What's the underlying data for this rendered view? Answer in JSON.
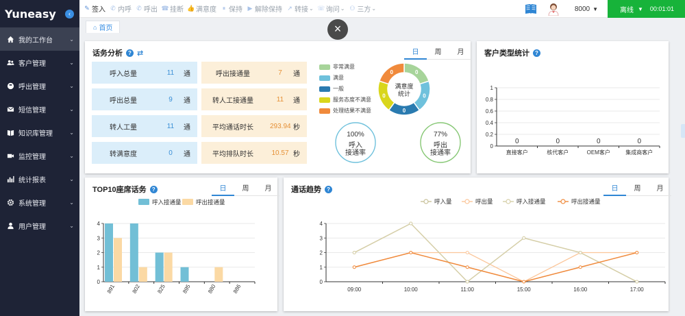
{
  "app": {
    "logo": "Yuneasy",
    "collapse_icon": "chevron-left-icon"
  },
  "sidebar": {
    "items": [
      {
        "label": "我的工作台",
        "icon": "home-icon",
        "active": true
      },
      {
        "label": "客户管理",
        "icon": "users-icon"
      },
      {
        "label": "呼出管理",
        "icon": "dial-icon"
      },
      {
        "label": "短信管理",
        "icon": "envelope-icon"
      },
      {
        "label": "知识库管理",
        "icon": "book-open-icon"
      },
      {
        "label": "监控管理",
        "icon": "video-icon"
      },
      {
        "label": "统计报表",
        "icon": "bar-chart-icon"
      },
      {
        "label": "系统管理",
        "icon": "gear-icon"
      },
      {
        "label": "用户管理",
        "icon": "user-icon"
      }
    ]
  },
  "toolbar": {
    "items": [
      {
        "label": "签入",
        "icon": "signin-icon",
        "enabled": true
      },
      {
        "label": "内呼",
        "icon": "phone-icon"
      },
      {
        "label": "呼出",
        "icon": "phone-out-icon"
      },
      {
        "label": "挂断",
        "icon": "hangup-icon"
      },
      {
        "label": "满意度",
        "icon": "thumb-icon"
      },
      {
        "label": "保持",
        "icon": "pause-icon"
      },
      {
        "label": "解除保持",
        "icon": "play-icon"
      },
      {
        "label": "转接",
        "icon": "transfer-icon",
        "caret": true
      },
      {
        "label": "询问",
        "icon": "ask-icon",
        "caret": true
      },
      {
        "label": "三方",
        "icon": "conference-icon",
        "caret": true
      }
    ],
    "extension": "8000",
    "status": "离线",
    "timer": "00:01:01"
  },
  "tabs": {
    "home": "首页"
  },
  "traffic": {
    "title": "话务分析",
    "periods": [
      "日",
      "周",
      "月"
    ],
    "stats": [
      {
        "label": "呼入总量",
        "value": "11",
        "unit": "通",
        "tone": "blue"
      },
      {
        "label": "呼出接通量",
        "value": "7",
        "unit": "通",
        "tone": "orange"
      },
      {
        "label": "呼出总量",
        "value": "9",
        "unit": "通",
        "tone": "blue"
      },
      {
        "label": "转人工接通量",
        "value": "11",
        "unit": "通",
        "tone": "orange"
      },
      {
        "label": "转人工量",
        "value": "11",
        "unit": "通",
        "tone": "blue"
      },
      {
        "label": "平均通话时长",
        "value": "293.94",
        "unit": "秒",
        "tone": "orange"
      },
      {
        "label": "转满意度",
        "value": "0",
        "unit": "通",
        "tone": "blue"
      },
      {
        "label": "平均排队时长",
        "value": "10.57",
        "unit": "秒",
        "tone": "orange"
      }
    ],
    "satisfaction_legend": [
      {
        "label": "非常满意",
        "color": "#a7d49a"
      },
      {
        "label": "满意",
        "color": "#6fc1dc"
      },
      {
        "label": "一般",
        "color": "#2a7bb0"
      },
      {
        "label": "服务态度不满意",
        "color": "#d9d61c"
      },
      {
        "label": "处理结果不满意",
        "color": "#f08a3c"
      }
    ],
    "donut": {
      "center_line1": "满意度",
      "center_line2": "统计",
      "values": [
        "0",
        "0",
        "0",
        "0",
        "0"
      ]
    },
    "rate_in": {
      "value": "100%",
      "line1": "呼入",
      "line2": "接通率",
      "color": "#6fc1dc"
    },
    "rate_out": {
      "value": "77%",
      "line1": "呼出",
      "line2": "接通率",
      "color": "#86c774"
    }
  },
  "customer_type": {
    "title": "客户类型统计",
    "chart_data": {
      "type": "bar",
      "categories": [
        "直接客户",
        "核代客户",
        "OEM客户",
        "集成商客户"
      ],
      "values": [
        0,
        0,
        0,
        0
      ],
      "yticks": [
        "0",
        "0.2",
        "0.4",
        "0.6",
        "0.8",
        "1"
      ],
      "ylim": [
        0,
        1
      ]
    }
  },
  "top10": {
    "title": "TOP10座席话务",
    "periods": [
      "日",
      "周",
      "月"
    ],
    "chart_data": {
      "type": "bar",
      "categories": [
        "891",
        "802",
        "825",
        "895",
        "880",
        "886"
      ],
      "series": [
        {
          "name": "呼入接通量",
          "values": [
            4,
            4,
            2,
            1,
            0,
            0
          ],
          "color": "#72bfd6"
        },
        {
          "name": "呼出接通量",
          "values": [
            3,
            1,
            2,
            0,
            1,
            0
          ],
          "color": "#fbd9a4"
        }
      ],
      "yticks": [
        "0",
        "1",
        "2",
        "3",
        "4"
      ],
      "ylim": [
        0,
        4
      ]
    }
  },
  "trend": {
    "title": "通话趋势",
    "periods": [
      "日",
      "周",
      "月"
    ],
    "chart_data": {
      "type": "line",
      "categories": [
        "09:00",
        "10:00",
        "11:00",
        "15:00",
        "16:00",
        "17:00"
      ],
      "series": [
        {
          "name": "呼入量",
          "values": [
            2,
            4,
            0,
            3,
            2,
            0
          ],
          "color": "#c9c29b"
        },
        {
          "name": "呼出量",
          "values": [
            1,
            2,
            2,
            0,
            2,
            2
          ],
          "color": "#fbc69a"
        },
        {
          "name": "呼入接通量",
          "values": [
            2,
            4,
            0,
            3,
            2,
            0
          ],
          "color": "#d6cfa8"
        },
        {
          "name": "呼出接通量",
          "values": [
            1,
            2,
            1,
            0,
            1,
            2
          ],
          "color": "#f08a3c"
        }
      ],
      "yticks": [
        "0",
        "1",
        "2",
        "3",
        "4"
      ],
      "ylim": [
        0,
        4
      ]
    }
  }
}
